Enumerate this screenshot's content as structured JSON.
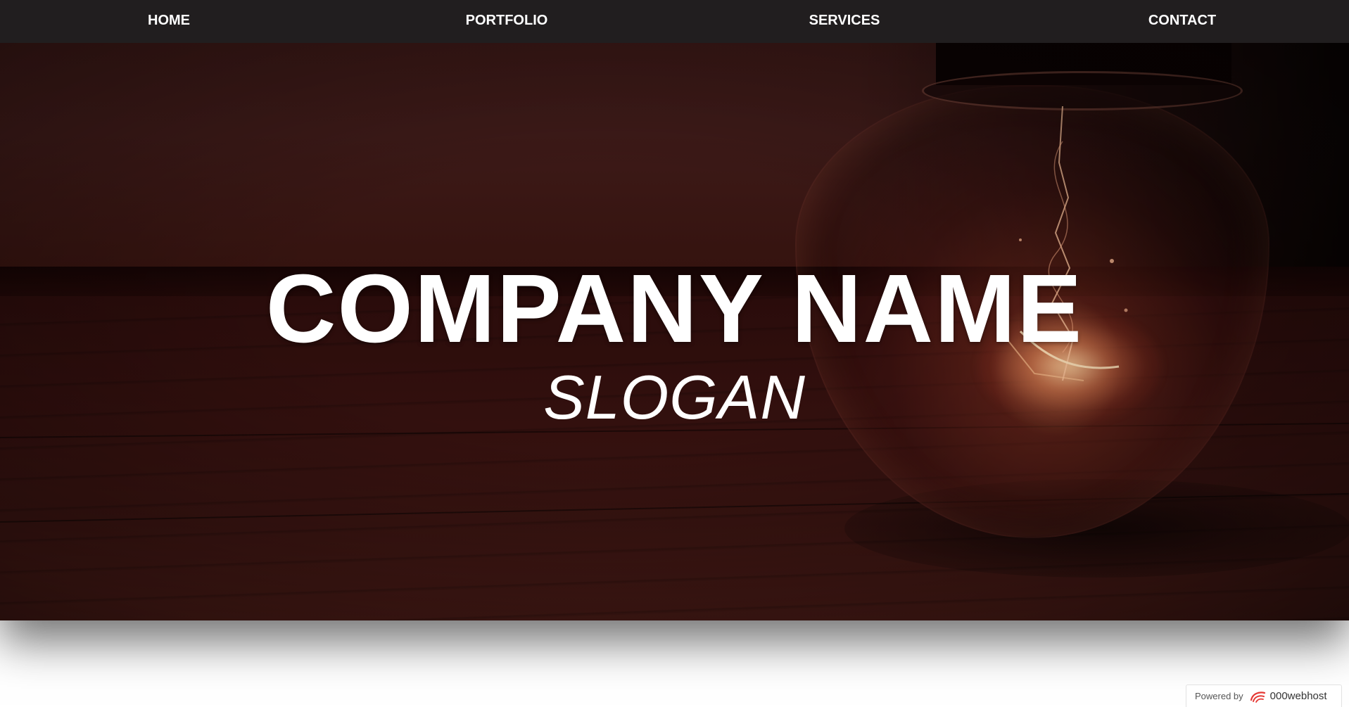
{
  "nav": {
    "items": [
      {
        "label": "HOME"
      },
      {
        "label": "PORTFOLIO"
      },
      {
        "label": "SERVICES"
      },
      {
        "label": "CONTACT"
      }
    ]
  },
  "hero": {
    "title": "COMPANY NAME",
    "slogan": "SLOGAN",
    "background_icon": "light-bulb-image"
  },
  "badge": {
    "powered_by": "Powered by",
    "brand": "000webhost",
    "logo_icon": "000webhost-logo-icon"
  },
  "colors": {
    "navbar": "#211e1f",
    "nav_text": "#ffffff",
    "hero_text": "#ffffff",
    "hero_tone": "#3a1513",
    "badge_logo": "#e53935"
  }
}
